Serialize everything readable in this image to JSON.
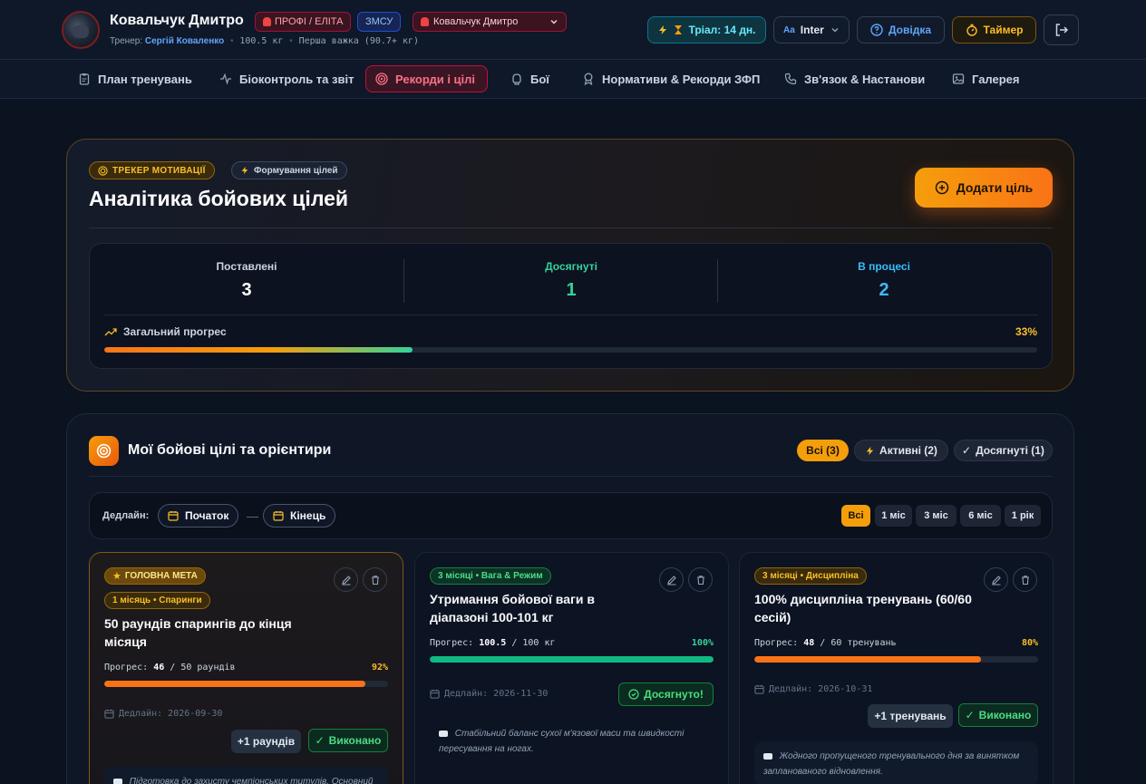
{
  "user": {
    "name": "Ковальчук Дмитро",
    "level_badge": "ПРОФІ / ЕЛІТА",
    "rank_badge": "ЗМСУ",
    "athlete_select": "Ковальчук Дмитро",
    "coach_label": "Тренер:",
    "coach_name": "Сергій Коваленко",
    "weight": "100.5 кг",
    "weight_class": "Перша важка (90.7+ кг)"
  },
  "header": {
    "trial": "Тріал: 14 дн.",
    "font_prefix": "Aa",
    "font_name": "Inter",
    "help": "Довідка",
    "timer": "Таймер"
  },
  "nav": {
    "items": [
      {
        "label": "План тренувань",
        "icon": "clipboard-icon"
      },
      {
        "label": "Біоконтроль та звіт",
        "icon": "pulse-icon"
      },
      {
        "label": "Рекорди і цілі",
        "icon": "target-icon",
        "active": true
      },
      {
        "label": "Бої",
        "icon": "glove-icon"
      },
      {
        "label": "Нормативи & Рекорди ЗФП",
        "icon": "award-icon"
      },
      {
        "label": "Зв'язок & Настанови",
        "icon": "phone-icon"
      },
      {
        "label": "Галерея",
        "icon": "image-icon"
      }
    ]
  },
  "analytics": {
    "tag_motivation": "ТРЕКЕР МОТИВАЦІЇ",
    "tag_forming": "Формування цілей",
    "title": "Аналітика бойових цілей",
    "add_goal": "Додати ціль",
    "stats": [
      {
        "label": "Поставлені",
        "value": "3",
        "color": "#cbd5e1",
        "num_color": "#ffffff"
      },
      {
        "label": "Досягнуті",
        "value": "1",
        "color": "#34d399",
        "num_color": "#34d399"
      },
      {
        "label": "В процесі",
        "value": "2",
        "color": "#38bdf8",
        "num_color": "#38bdf8"
      }
    ],
    "overall_label": "Загальний прогрес",
    "overall_pct": "33%",
    "overall_value": 0.33
  },
  "goals_section": {
    "title": "Мої бойові цілі та орієнтири",
    "filters": {
      "all": "Всі (3)",
      "active": "Активні (2)",
      "done": "Досягнуті (1)"
    },
    "deadline_label": "Дедлайн:",
    "start": "Початок",
    "dash": "—",
    "end": "Кінець",
    "ranges": [
      "Всі",
      "1 міс",
      "3 міс",
      "6 міс",
      "1 рік"
    ]
  },
  "goals": [
    {
      "main_tag": "ГОЛОВНА МЕТА",
      "tag": "1 місяць • Спаринги",
      "title": "50 раундів спарингів до кінця місяця",
      "progress_label": "Прогрес:",
      "progress_current": "46",
      "progress_total": "/ 50 раундів",
      "pct": "92%",
      "value": 0.92,
      "deadline": "Дедлайн: 2026-09-30",
      "plus_btn": "+1 раундів",
      "done_btn": "Виконано",
      "note": "Підготовка до захисту чемпіонських титулів. Основний"
    },
    {
      "tag": "3 місяці • Вага & Режим",
      "title": "Утримання бойової ваги в діапазоні 100-101 кг",
      "progress_label": "Прогрес:",
      "progress_current": "100.5",
      "progress_total": "/ 100 кг",
      "pct": "100%",
      "value": 1.0,
      "deadline": "Дедлайн: 2026-11-30",
      "achieved": "Досягнуто!",
      "note": "Стабільний баланс сухої м'язової маси та швидкості пересування на ногах."
    },
    {
      "tag": "3 місяці • Дисципліна",
      "title": "100% дисципліна тренувань (60/60 сесій)",
      "progress_label": "Прогрес:",
      "progress_current": "48",
      "progress_total": "/ 60 тренувань",
      "pct": "80%",
      "value": 0.8,
      "deadline": "Дедлайн: 2026-10-31",
      "plus_btn": "+1 тренувань",
      "done_btn": "Виконано",
      "note": "Жодного пропущеного тренувального дня за винятком запланованого відновлення."
    }
  ]
}
